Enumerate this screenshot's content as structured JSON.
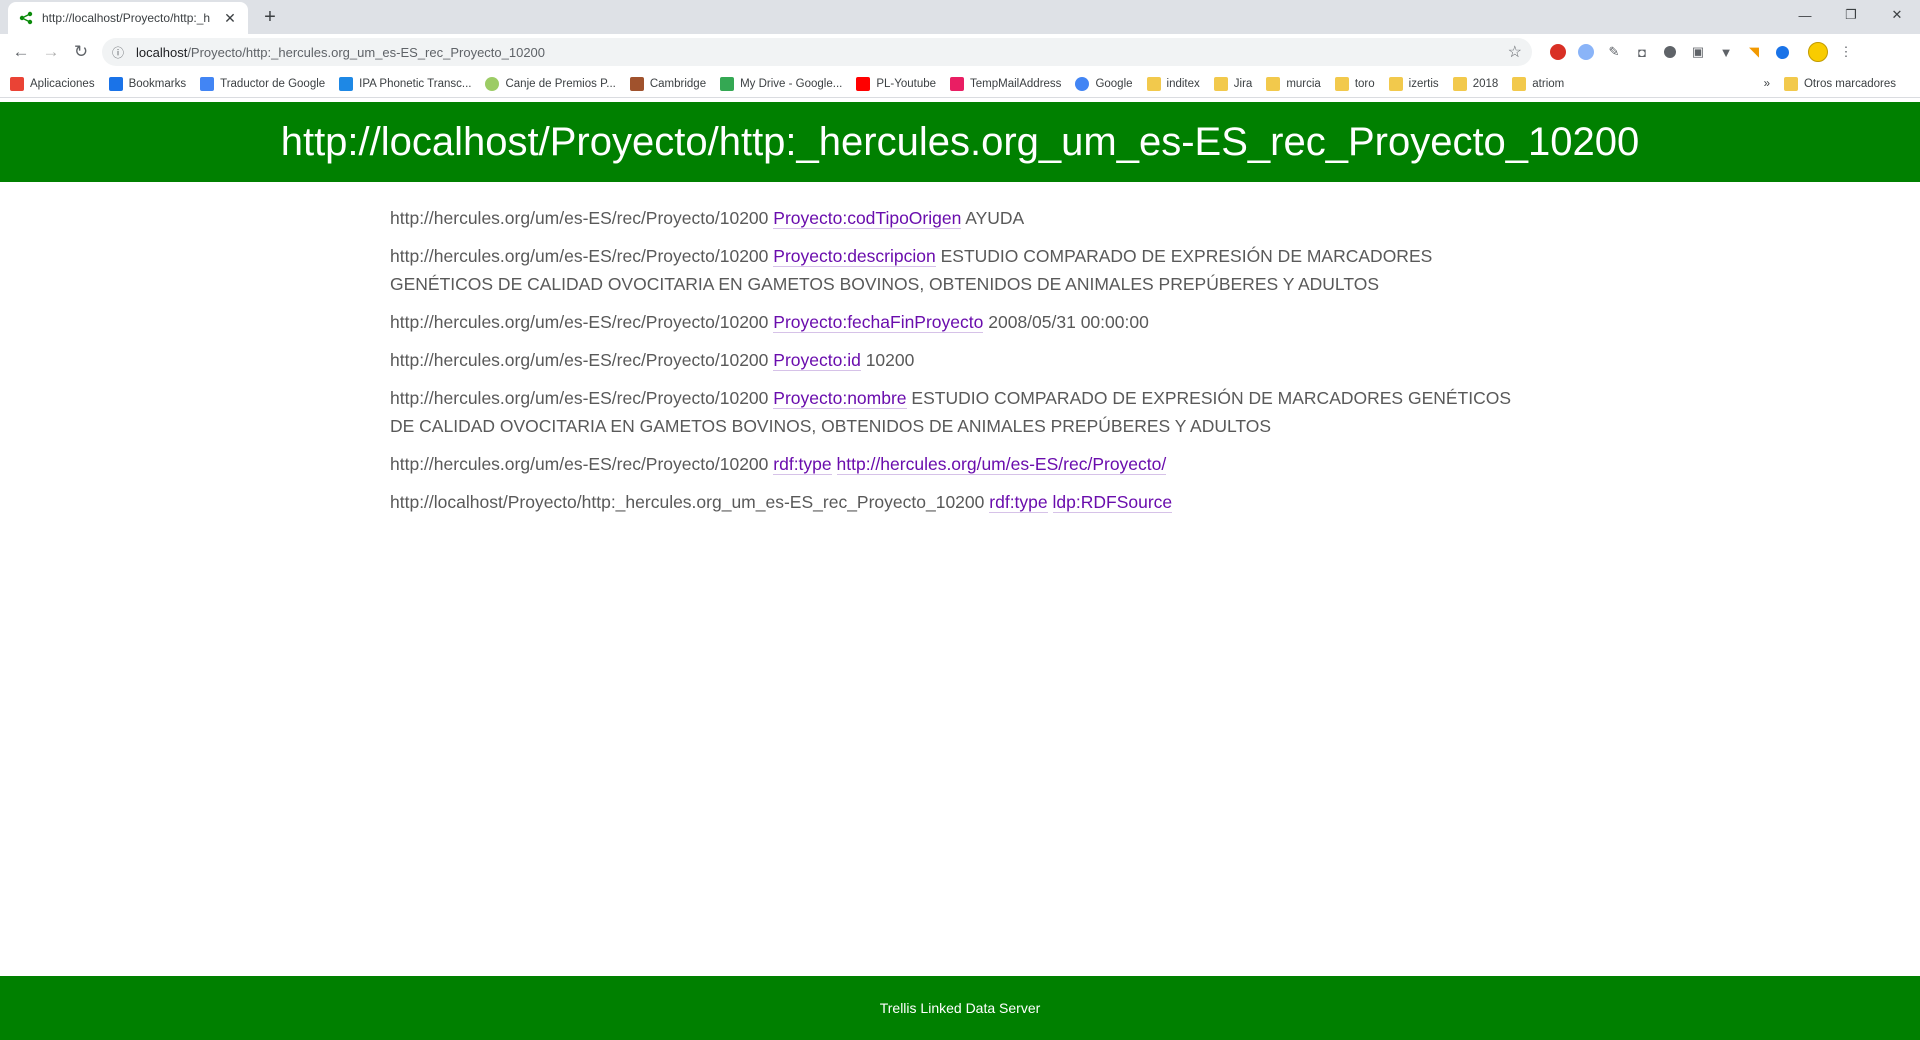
{
  "browser": {
    "tab_title": "http://localhost/Proyecto/http:_h",
    "new_tab": "+",
    "address_host": "localhost",
    "address_path": "/Proyecto/http:_hercules.org_um_es-ES_rec_Proyecto_10200",
    "bookmarks": [
      {
        "label": "Aplicaciones",
        "icon": "apps-grid-icon"
      },
      {
        "label": "Bookmarks",
        "icon": "star-icon"
      },
      {
        "label": "Traductor de Google",
        "icon": "translate-icon"
      },
      {
        "label": "IPA Phonetic Transc...",
        "icon": "ipa-icon"
      },
      {
        "label": "Canje de Premios P...",
        "icon": "circle-icon"
      },
      {
        "label": "Cambridge",
        "icon": "cambridge-icon"
      },
      {
        "label": "My Drive - Google...",
        "icon": "drive-icon"
      },
      {
        "label": "PL-Youtube",
        "icon": "youtube-icon"
      },
      {
        "label": "TempMailAddress",
        "icon": "mail-icon"
      },
      {
        "label": "Google",
        "icon": "google-icon"
      },
      {
        "label": "inditex",
        "icon": "folder-icon"
      },
      {
        "label": "Jira",
        "icon": "folder-icon"
      },
      {
        "label": "murcia",
        "icon": "folder-icon"
      },
      {
        "label": "toro",
        "icon": "folder-icon"
      },
      {
        "label": "izertis",
        "icon": "folder-icon"
      },
      {
        "label": "2018",
        "icon": "folder-icon"
      },
      {
        "label": "atriom",
        "icon": "folder-icon"
      }
    ],
    "more_bookmarks": "»",
    "other_bookmarks": "Otros marcadores"
  },
  "page": {
    "header_title": "http://localhost/Proyecto/http:_hercules.org_um_es-ES_rec_Proyecto_10200",
    "triples": [
      {
        "subject": "http://hercules.org/um/es-ES/rec/Proyecto/10200",
        "predicate": "Proyecto:codTipoOrigen",
        "object": "AYUDA",
        "object_link": false
      },
      {
        "subject": "http://hercules.org/um/es-ES/rec/Proyecto/10200",
        "predicate": "Proyecto:descripcion",
        "object": "ESTUDIO COMPARADO DE EXPRESIÓN DE MARCADORES GENÉTICOS DE CALIDAD OVOCITARIA EN GAMETOS BOVINOS, OBTENIDOS DE ANIMALES PREPÚBERES Y ADULTOS",
        "object_link": false
      },
      {
        "subject": "http://hercules.org/um/es-ES/rec/Proyecto/10200",
        "predicate": "Proyecto:fechaFinProyecto",
        "object": "2008/05/31 00:00:00",
        "object_link": false
      },
      {
        "subject": "http://hercules.org/um/es-ES/rec/Proyecto/10200",
        "predicate": "Proyecto:id",
        "object": "10200",
        "object_link": false
      },
      {
        "subject": "http://hercules.org/um/es-ES/rec/Proyecto/10200",
        "predicate": "Proyecto:nombre",
        "object": "ESTUDIO COMPARADO DE EXPRESIÓN DE MARCADORES GENÉTICOS DE CALIDAD OVOCITARIA EN GAMETOS BOVINOS, OBTENIDOS DE ANIMALES PREPÚBERES Y ADULTOS",
        "object_link": false
      },
      {
        "subject": "http://hercules.org/um/es-ES/rec/Proyecto/10200",
        "predicate": "rdf:type",
        "object": "http://hercules.org/um/es-ES/rec/Proyecto/",
        "object_link": true
      },
      {
        "subject": "http://localhost/Proyecto/http:_hercules.org_um_es-ES_rec_Proyecto_10200",
        "predicate": "rdf:type",
        "object": "ldp:RDFSource",
        "object_link": true
      }
    ],
    "footer": "Trellis Linked Data Server"
  },
  "colors": {
    "brand_green": "#008000",
    "link_purple": "#6a0dad"
  }
}
